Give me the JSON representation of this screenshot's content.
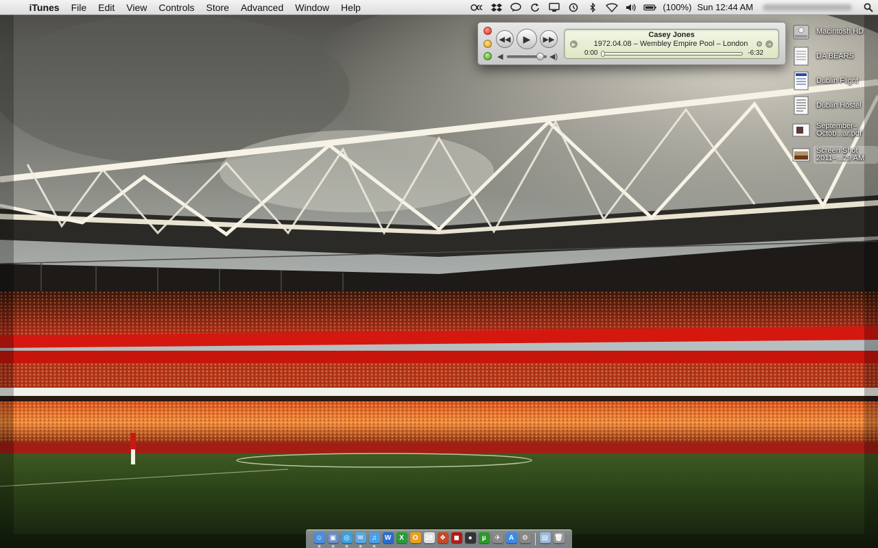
{
  "menubar": {
    "apple_glyph": "",
    "app_name": "iTunes",
    "menus": [
      "File",
      "Edit",
      "View",
      "Controls",
      "Store",
      "Advanced",
      "Window",
      "Help"
    ],
    "battery": "(100%)",
    "clock": "Sun 12:44 AM"
  },
  "player": {
    "track_title": "Casey Jones",
    "track_subtitle": "1972.04.08 – Wembley Empire Pool – London",
    "elapsed": "0:00",
    "remaining": "-6:32",
    "progress": 0.0,
    "volume": 0.85
  },
  "desktop": {
    "items": [
      {
        "label": "Macintosh HD",
        "icon": "hard-drive-icon"
      },
      {
        "label": "DA BEARS",
        "icon": "document-icon"
      },
      {
        "label": "Dublin Flight",
        "icon": "document-icon"
      },
      {
        "label": "Dublin Hostel",
        "icon": "document-icon"
      },
      {
        "label": "September–Octob...ar.pdf",
        "icon": "pdf-icon"
      },
      {
        "label": "Screen Shot 2011–...29 AM",
        "icon": "screenshot-icon"
      }
    ]
  },
  "dock": {
    "apps": [
      {
        "name": "finder",
        "color": "#4a8fe0",
        "glyph": "☺"
      },
      {
        "name": "preview",
        "color": "#6a8cc8",
        "glyph": "▣"
      },
      {
        "name": "safari",
        "color": "#3aa0e0",
        "glyph": "◎"
      },
      {
        "name": "ichat",
        "color": "#58a8e8",
        "glyph": "✉"
      },
      {
        "name": "itunes",
        "color": "#4aa0e8",
        "glyph": "♫"
      },
      {
        "name": "word",
        "color": "#2a6ad0",
        "glyph": "W"
      },
      {
        "name": "excel",
        "color": "#2a9a3a",
        "glyph": "X"
      },
      {
        "name": "outlook",
        "color": "#e8a020",
        "glyph": "O"
      },
      {
        "name": "ical",
        "color": "#e0e0e0",
        "glyph": "28"
      },
      {
        "name": "photos",
        "color": "#c04a2a",
        "glyph": "❖"
      },
      {
        "name": "photo-booth",
        "color": "#b01a1a",
        "glyph": "◼"
      },
      {
        "name": "facetime",
        "color": "#333333",
        "glyph": "●"
      },
      {
        "name": "utorrent",
        "color": "#2a9a2a",
        "glyph": "µ"
      },
      {
        "name": "system-tools",
        "color": "#8a8a8a",
        "glyph": "✈"
      },
      {
        "name": "app-store",
        "color": "#3a8ae8",
        "glyph": "A"
      },
      {
        "name": "system-preferences",
        "color": "#888888",
        "glyph": "⚙"
      }
    ],
    "trailing": [
      {
        "name": "documents-stack",
        "color": "#9ab8d8",
        "glyph": "▤"
      },
      {
        "name": "trash",
        "color": "#9a9a9a",
        "glyph": "🗑"
      }
    ]
  }
}
